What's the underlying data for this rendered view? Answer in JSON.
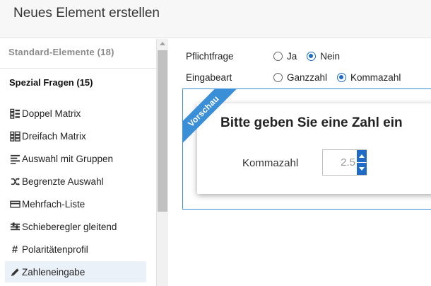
{
  "header": {
    "title": "Neues Element erstellen"
  },
  "sidebar": {
    "standard_section": "Standard-Elemente (18)",
    "spezial_section": "Spezial Fragen (15)",
    "items": [
      {
        "label": "Doppel Matrix",
        "icon": "double-matrix-icon"
      },
      {
        "label": "Dreifach Matrix",
        "icon": "triple-matrix-icon"
      },
      {
        "label": "Auswahl mit Gruppen",
        "icon": "grouped-list-icon"
      },
      {
        "label": "Begrenzte Auswahl",
        "icon": "shuffle-icon"
      },
      {
        "label": "Mehrfach-Liste",
        "icon": "card-icon"
      },
      {
        "label": "Schieberegler gleitend",
        "icon": "slider-icon"
      },
      {
        "label": "Polaritätenprofil",
        "icon": "hash-icon",
        "glyph": "#"
      },
      {
        "label": "Zahleneingabe",
        "icon": "pencil-icon",
        "selected": true
      }
    ]
  },
  "form": {
    "pflichtfrage": {
      "label": "Pflichtfrage",
      "options": [
        "Ja",
        "Nein"
      ],
      "selected": "Nein"
    },
    "eingabeart": {
      "label": "Eingabeart",
      "options": [
        "Ganzzahl",
        "Kommazahl"
      ],
      "selected": "Kommazahl"
    }
  },
  "preview": {
    "ribbon": "Vorschau",
    "question": "Bitte geben Sie eine Zahl ein",
    "field_label": "Kommazahl",
    "value": "2.5"
  },
  "colors": {
    "accent": "#1f6cc6",
    "ribbon": "#3a8fd6",
    "selected_bg": "#eaf1f9"
  }
}
